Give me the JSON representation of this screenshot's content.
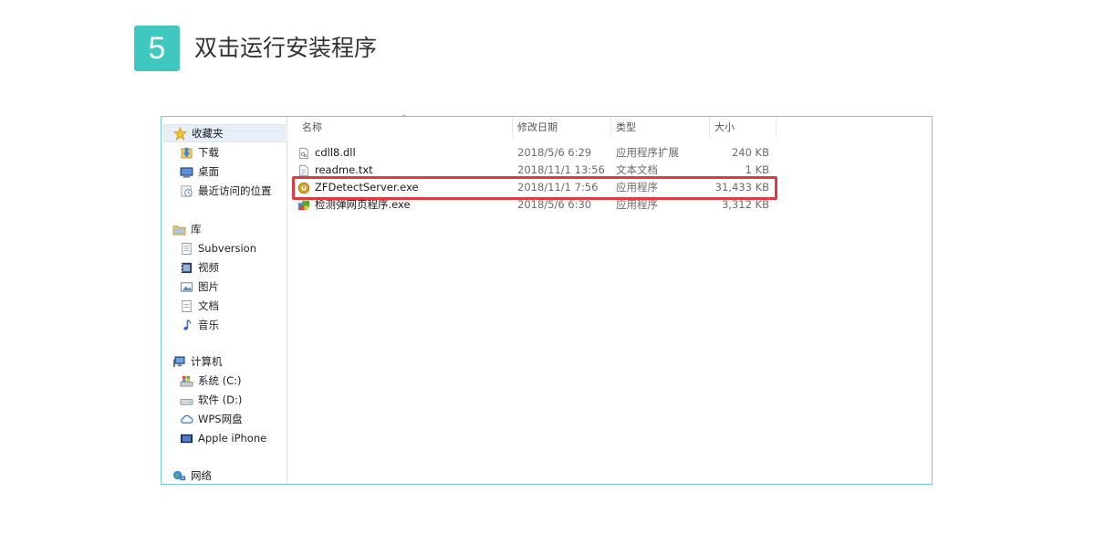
{
  "step": {
    "number": "5",
    "title": "双击运行安装程序"
  },
  "colors": {
    "badge": "#3ec8bf",
    "highlight_border": "#e8383f",
    "window_border": "#6ecfd6"
  },
  "nav": {
    "favorites": {
      "label": "收藏夹",
      "icon": "star-icon",
      "items": [
        {
          "label": "下载",
          "icon": "downloads-icon"
        },
        {
          "label": "桌面",
          "icon": "desktop-icon"
        },
        {
          "label": "最近访问的位置",
          "icon": "recent-places-icon"
        }
      ]
    },
    "libraries": {
      "label": "库",
      "icon": "library-icon",
      "items": [
        {
          "label": "Subversion",
          "icon": "document-library-icon"
        },
        {
          "label": "视频",
          "icon": "video-icon"
        },
        {
          "label": "图片",
          "icon": "pictures-icon"
        },
        {
          "label": "文档",
          "icon": "documents-icon"
        },
        {
          "label": "音乐",
          "icon": "music-icon"
        }
      ]
    },
    "computer": {
      "label": "计算机",
      "icon": "computer-icon",
      "items": [
        {
          "label": "系统 (C:)",
          "icon": "system-drive-icon"
        },
        {
          "label": "软件 (D:)",
          "icon": "drive-icon"
        },
        {
          "label": "WPS网盘",
          "icon": "cloud-icon"
        },
        {
          "label": "Apple iPhone",
          "icon": "iphone-icon"
        }
      ]
    },
    "network": {
      "label": "网络",
      "icon": "network-icon"
    }
  },
  "columns": {
    "name": "名称",
    "modified": "修改日期",
    "type": "类型",
    "size": "大小"
  },
  "files": [
    {
      "name": "cdll8.dll",
      "modified": "2018/5/6 6:29",
      "type": "应用程序扩展",
      "size": "240 KB",
      "icon": "dll-file-icon"
    },
    {
      "name": "readme.txt",
      "modified": "2018/11/1 13:56",
      "type": "文本文档",
      "size": "1 KB",
      "icon": "text-file-icon"
    },
    {
      "name": "ZFDetectServer.exe",
      "modified": "2018/11/1 7:56",
      "type": "应用程序",
      "size": "31,433 KB",
      "icon": "exe-app-icon",
      "highlighted": true
    },
    {
      "name": "检测弹网页程序.exe",
      "modified": "2018/5/6 6:30",
      "type": "应用程序",
      "size": "3,312 KB",
      "icon": "exe-app-icon"
    }
  ]
}
